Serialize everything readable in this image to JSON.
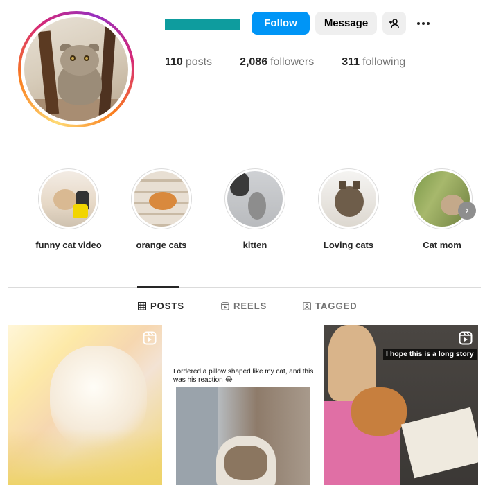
{
  "profile": {
    "avatar_alt": "profile-photo",
    "username_redacted": true
  },
  "actions": {
    "follow_label": "Follow",
    "message_label": "Message",
    "add_user_icon": "person-plus-icon",
    "more_icon": "more-horizontal-icon"
  },
  "stats": [
    {
      "value": "110",
      "label": "posts"
    },
    {
      "value": "2,086",
      "label": "followers"
    },
    {
      "value": "311",
      "label": "following"
    }
  ],
  "highlights": [
    {
      "label": "funny cat video"
    },
    {
      "label": "orange cats"
    },
    {
      "label": "kitten"
    },
    {
      "label": "Loving cats"
    },
    {
      "label": "Cat mom"
    }
  ],
  "tabs": [
    {
      "label": "POSTS",
      "icon": "grid-icon",
      "active": true
    },
    {
      "label": "REELS",
      "icon": "reels-icon",
      "active": false
    },
    {
      "label": "TAGGED",
      "icon": "tagged-icon",
      "active": false
    }
  ],
  "posts": [
    {
      "type": "reel",
      "caption": ""
    },
    {
      "type": "image",
      "caption": "I ordered a pillow shaped like my cat, and this was his reaction 😂"
    },
    {
      "type": "reel",
      "caption": "I hope this is a long story"
    }
  ],
  "colors": {
    "primary_button": "#0095f6",
    "secondary_button": "#efefef",
    "username_redaction": "#0e9c9e",
    "divider": "#dbdbdb"
  }
}
